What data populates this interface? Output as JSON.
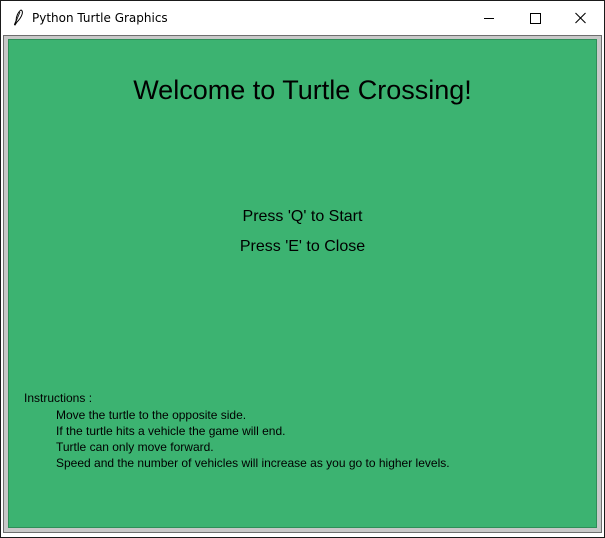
{
  "window": {
    "title": "Python Turtle Graphics",
    "icon": "feather-quill-icon",
    "controls": [
      "minimize-icon",
      "maximize-icon",
      "close-icon"
    ]
  },
  "canvas": {
    "background": "#3cb371",
    "welcome_text": "Welcome to Turtle Crossing!",
    "start_prompt": "Press 'Q' to Start",
    "close_prompt": "Press 'E' to Close",
    "instructions": {
      "heading": "Instructions :",
      "items": [
        "Move the turtle to the opposite side.",
        "If the turtle hits a vehicle the game will end.",
        "Turtle can only move forward.",
        "Speed and the number of vehicles will increase as you go to higher levels."
      ]
    }
  }
}
